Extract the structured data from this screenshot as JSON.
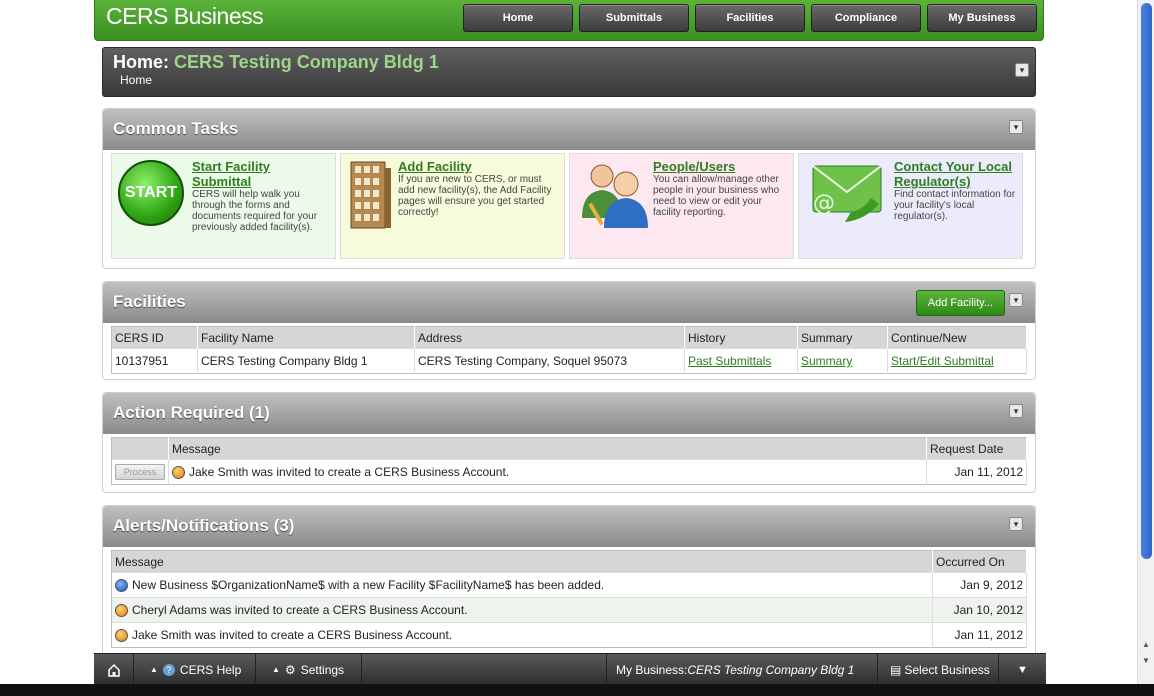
{
  "topbar": {
    "brand": "CERS Business",
    "nav": [
      "Home",
      "Submittals",
      "Facilities",
      "Compliance",
      "My Business"
    ]
  },
  "header": {
    "title_prefix": "Home: ",
    "title_name": "CERS Testing Company Bldg 1",
    "breadcrumb": "Home"
  },
  "common_tasks": {
    "title": "Common Tasks",
    "start_label": "START",
    "items": [
      {
        "title": "Start Facility Submittal",
        "desc": "CERS will help walk you through the forms and documents required for your previously added facility(s)."
      },
      {
        "title": "Add Facility",
        "desc": "If you are new to CERS, or must add new facility(s), the Add Facility pages will ensure you get started correctly!"
      },
      {
        "title": "People/Users",
        "desc": "You can allow/manage other people in your business who need to view or edit your facility reporting."
      },
      {
        "title": "Contact Your Local Regulator(s)",
        "desc": "Find contact information for your facility's local regulator(s)."
      }
    ]
  },
  "facilities": {
    "title": "Facilities",
    "add_button": "Add Facility...",
    "columns": [
      "CERS ID",
      "Facility Name",
      "Address",
      "History",
      "Summary",
      "Continue/New"
    ],
    "rows": [
      {
        "id": "10137951",
        "name": "CERS Testing Company Bldg 1",
        "address": "CERS Testing Company, Soquel 95073",
        "history": "Past Submittals",
        "summary": "Summary",
        "continue": "Start/Edit Submittal"
      }
    ]
  },
  "action_required": {
    "title": "Action Required (1)",
    "columns": [
      "Message",
      "Request Date"
    ],
    "process_label": "Process",
    "rows": [
      {
        "message": "Jake Smith was invited to create a CERS Business Account.",
        "date": "Jan 11, 2012"
      }
    ]
  },
  "alerts": {
    "title": "Alerts/Notifications (3)",
    "columns": [
      "Message",
      "Occurred On"
    ],
    "rows": [
      {
        "message": "New Business $OrganizationName$ with a new Facility $FacilityName$ has been added.",
        "date": "Jan 9, 2012",
        "color": "blue"
      },
      {
        "message": "Cheryl Adams was invited to create a CERS Business Account.",
        "date": "Jan 10, 2012",
        "color": "orange"
      },
      {
        "message": "Jake Smith was invited to create a CERS Business Account.",
        "date": "Jan 11, 2012",
        "color": "orange"
      }
    ]
  },
  "bottombar": {
    "help": "CERS Help",
    "settings": "Settings",
    "my_business_label": "My Business: ",
    "my_business_name": "CERS Testing Company Bldg 1",
    "select_business": "Select Business"
  },
  "colors": {
    "brand_green": "#3a8f1f",
    "link_green": "#2e7d1e"
  }
}
